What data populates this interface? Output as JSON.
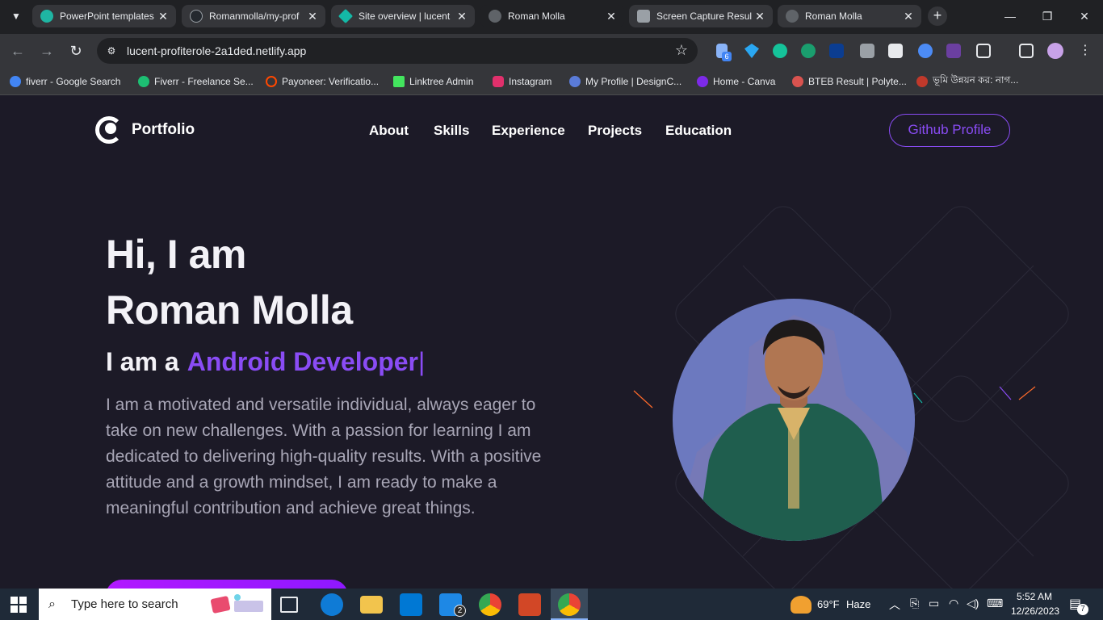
{
  "browser": {
    "tabs": [
      {
        "title": "PowerPoint templates",
        "favicon_color": "#1fb5a3"
      },
      {
        "title": "Romanmolla/my-prof",
        "favicon_color": "#24292f"
      },
      {
        "title": "Site overview | lucent",
        "favicon_color": "#14b8a6"
      },
      {
        "title": "Roman Molla",
        "favicon_color": "#5f6368"
      },
      {
        "title": "Screen Capture Resul",
        "favicon_color": "#9aa0a6"
      },
      {
        "title": "Roman Molla",
        "favicon_color": "#5f6368"
      }
    ],
    "active_tab_index": 3,
    "url": "lucent-profiterole-2a1ded.netlify.app",
    "extension_badge": "6",
    "bookmarks": [
      {
        "label": "fiverr - Google Search",
        "icon_color": "#4285f4"
      },
      {
        "label": "Fiverr - Freelance Se...",
        "icon_color": "#1dbf73"
      },
      {
        "label": "Payoneer: Verificatio...",
        "icon_color": "#ff4800"
      },
      {
        "label": "Linktree Admin",
        "icon_color": "#43e55e"
      },
      {
        "label": "Instagram",
        "icon_color": "#e1306c"
      },
      {
        "label": "My Profile | DesignC...",
        "icon_color": "#5a7bd8"
      },
      {
        "label": "Home - Canva",
        "icon_color": "#7d2ae8"
      },
      {
        "label": "BTEB Result | Polyte...",
        "icon_color": "#d9534f"
      },
      {
        "label": "ভূমি উন্নয়ন কর: নাগ...",
        "icon_color": "#c0392b"
      }
    ]
  },
  "site": {
    "logo_text": "Portfolio",
    "nav": [
      "About",
      "Skills",
      "Experience",
      "Projects",
      "Education"
    ],
    "github_button": "Github Profile",
    "hero_line1": "Hi, I am",
    "hero_line2": "Roman Molla",
    "role_prefix": "I am a",
    "role_typed": "Android Developer",
    "role_caret": "|",
    "bio": "I am a motivated and versatile individual, always eager to take on new challenges. With a passion for learning I am dedicated to delivering high-quality results. With a positive attitude and a growth mindset, I am ready to make a meaningful contribution and achieve great things.",
    "colors": {
      "background": "#1c1a27",
      "accent": "#8a4cf5",
      "avatar_bg": "#6c79bf"
    }
  },
  "taskbar": {
    "search_placeholder": "Type here to search",
    "weather_temp": "69°F",
    "weather_desc": "Haze",
    "time": "5:52 AM",
    "date": "12/26/2023",
    "mail_badge": "2",
    "notification_count": "7"
  }
}
